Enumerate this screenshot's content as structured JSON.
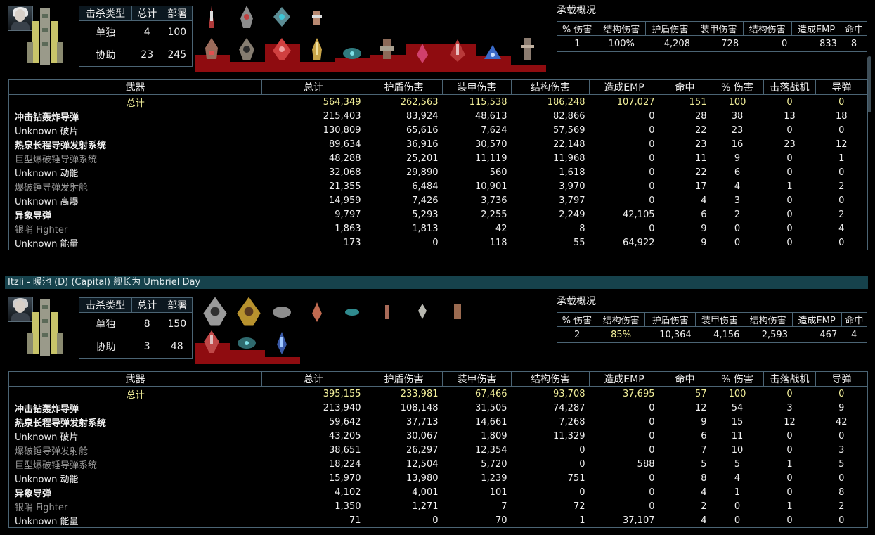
{
  "colors": {
    "total": "#f2ef9a",
    "grey_name": "#9a9a9a",
    "banner": "#16424c",
    "red_bar": "#8f0c10",
    "percent_highlight": "#f2ef9a"
  },
  "kill_headers": [
    "击杀类型",
    "总计",
    "部署"
  ],
  "summary_title": "承载概况",
  "summary_headers": [
    "% 伤害",
    "结构伤害",
    "护盾伤害",
    "装甲伤害",
    "结构伤害",
    "造成EMP",
    "命中"
  ],
  "weapon_headers": [
    "武器",
    "总计",
    "护盾伤害",
    "装甲伤害",
    "结构伤害",
    "造成EMP",
    "命中",
    "% 伤害",
    "击落战机",
    "导弹"
  ],
  "ships": [
    {
      "kills": [
        {
          "type": "单独",
          "total": "4",
          "deploy": "100"
        },
        {
          "type": "协助",
          "total": "23",
          "deploy": "245"
        }
      ],
      "summary": [
        "1",
        "100%",
        "4,208",
        "728",
        "0",
        "833",
        "8"
      ],
      "weapons": [
        {
          "style": "total",
          "cells": [
            "总计",
            "564,349",
            "262,563",
            "115,538",
            "186,248",
            "107,027",
            "151",
            "100",
            "0",
            "0"
          ]
        },
        {
          "style": "bold",
          "cells": [
            "冲击钻轰炸导弹",
            "215,403",
            "83,924",
            "48,613",
            "82,866",
            "0",
            "28",
            "38",
            "13",
            "18"
          ]
        },
        {
          "style": "normal",
          "cells": [
            "Unknown 破片",
            "130,809",
            "65,616",
            "7,624",
            "57,569",
            "0",
            "22",
            "23",
            "0",
            "0"
          ]
        },
        {
          "style": "bold",
          "cells": [
            "热泉长程导弹发射系统",
            "89,634",
            "36,916",
            "30,570",
            "22,148",
            "0",
            "23",
            "16",
            "23",
            "12"
          ]
        },
        {
          "style": "grey",
          "cells": [
            "巨型爆破锤导弹系统",
            "48,288",
            "25,201",
            "11,119",
            "11,968",
            "0",
            "11",
            "9",
            "0",
            "1"
          ]
        },
        {
          "style": "normal",
          "cells": [
            "Unknown 动能",
            "32,068",
            "29,890",
            "560",
            "1,618",
            "0",
            "22",
            "6",
            "0",
            "0"
          ]
        },
        {
          "style": "grey",
          "cells": [
            "爆破锤导弹发射舱",
            "21,355",
            "6,484",
            "10,901",
            "3,970",
            "0",
            "17",
            "4",
            "1",
            "2"
          ]
        },
        {
          "style": "normal",
          "cells": [
            "Unknown 高爆",
            "14,959",
            "7,426",
            "3,736",
            "3,797",
            "0",
            "4",
            "3",
            "0",
            "0"
          ]
        },
        {
          "style": "bold",
          "cells": [
            "异象导弹",
            "9,797",
            "5,293",
            "2,255",
            "2,249",
            "42,105",
            "6",
            "2",
            "0",
            "2"
          ]
        },
        {
          "style": "grey",
          "cells": [
            "银哨 Fighter",
            "1,863",
            "1,813",
            "42",
            "8",
            "0",
            "9",
            "0",
            "0",
            "4"
          ]
        },
        {
          "style": "normal",
          "cells": [
            "Unknown 能量",
            "173",
            "0",
            "118",
            "55",
            "64,922",
            "9",
            "0",
            "0",
            "0"
          ]
        }
      ]
    },
    {
      "banner": "Itzli - 暖池 (D) (Capital) 舰长为 Umbriel Day",
      "kills": [
        {
          "type": "单独",
          "total": "8",
          "deploy": "150"
        },
        {
          "type": "协助",
          "total": "3",
          "deploy": "48"
        }
      ],
      "summary": [
        "2",
        "85%",
        "10,364",
        "4,156",
        "2,593",
        "467",
        "4"
      ],
      "weapons": [
        {
          "style": "total",
          "cells": [
            "总计",
            "395,155",
            "233,981",
            "67,466",
            "93,708",
            "37,695",
            "57",
            "100",
            "0",
            "0"
          ]
        },
        {
          "style": "bold",
          "cells": [
            "冲击钻轰炸导弹",
            "213,940",
            "108,148",
            "31,505",
            "74,287",
            "0",
            "12",
            "54",
            "3",
            "9"
          ]
        },
        {
          "style": "bold",
          "cells": [
            "热泉长程导弹发射系统",
            "59,642",
            "37,713",
            "14,661",
            "7,268",
            "0",
            "9",
            "15",
            "12",
            "42"
          ]
        },
        {
          "style": "normal",
          "cells": [
            "Unknown 破片",
            "43,205",
            "30,067",
            "1,809",
            "11,329",
            "0",
            "6",
            "11",
            "0",
            "0"
          ]
        },
        {
          "style": "grey",
          "cells": [
            "爆破锤导弹发射舱",
            "38,651",
            "26,297",
            "12,354",
            "0",
            "0",
            "7",
            "10",
            "0",
            "3"
          ]
        },
        {
          "style": "grey",
          "cells": [
            "巨型爆破锤导弹系统",
            "18,224",
            "12,504",
            "5,720",
            "0",
            "588",
            "5",
            "5",
            "1",
            "5"
          ]
        },
        {
          "style": "normal",
          "cells": [
            "Unknown 动能",
            "15,970",
            "13,980",
            "1,239",
            "751",
            "0",
            "8",
            "4",
            "0",
            "0"
          ]
        },
        {
          "style": "bold",
          "cells": [
            "异象导弹",
            "4,102",
            "4,001",
            "101",
            "0",
            "0",
            "4",
            "1",
            "0",
            "8"
          ]
        },
        {
          "style": "grey",
          "cells": [
            "银哨 Fighter",
            "1,350",
            "1,271",
            "7",
            "72",
            "0",
            "2",
            "0",
            "1",
            "2"
          ]
        },
        {
          "style": "normal",
          "cells": [
            "Unknown 能量",
            "71",
            "0",
            "70",
            "1",
            "37,107",
            "4",
            "0",
            "0",
            "0"
          ]
        }
      ]
    }
  ]
}
